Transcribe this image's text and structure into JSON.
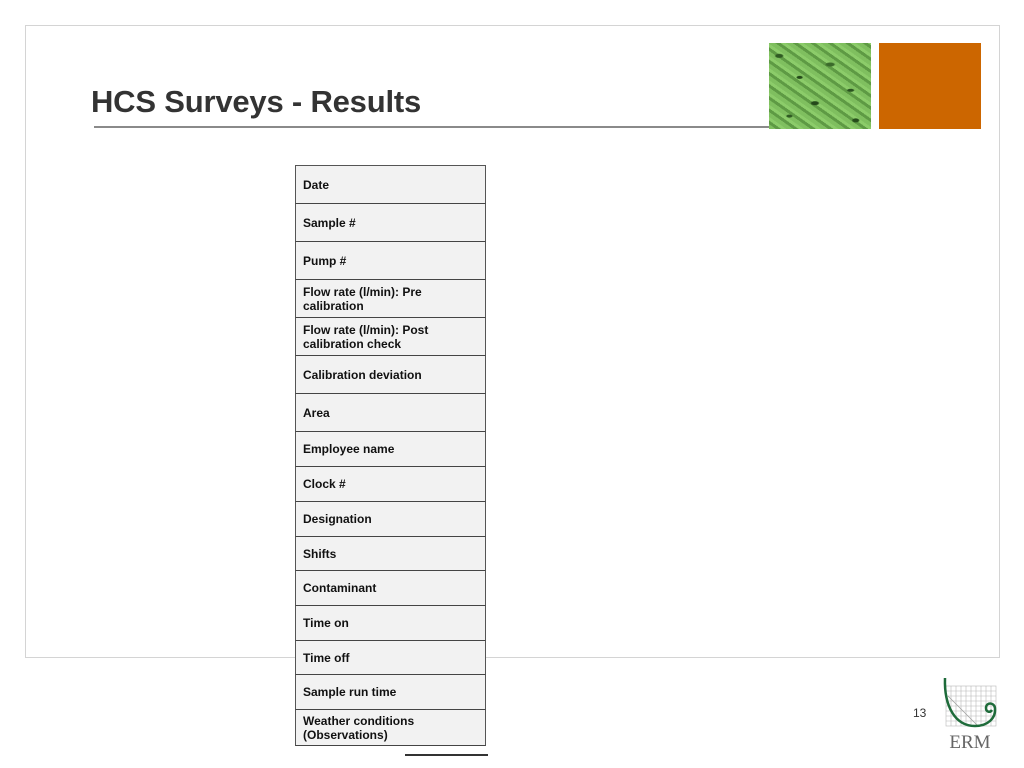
{
  "slide": {
    "title": "HCS Surveys - Results",
    "page_number": "13",
    "logo_text": "ERM",
    "accent_color": "#cc6600",
    "logo_green": "#1e6b3a"
  },
  "table": {
    "rows": [
      {
        "label": "Date"
      },
      {
        "label": "Sample #"
      },
      {
        "label": "Pump #"
      },
      {
        "label": "Flow rate (l/min):  Pre calibration"
      },
      {
        "label": "Flow rate (l/min):  Post calibration check"
      },
      {
        "label": "Calibration deviation"
      },
      {
        "label": "Area"
      },
      {
        "label": "Employee name"
      },
      {
        "label": "Clock #"
      },
      {
        "label": "Designation"
      },
      {
        "label": "Shifts"
      },
      {
        "label": "Contaminant"
      },
      {
        "label": "Time on"
      },
      {
        "label": "Time off"
      },
      {
        "label": "Sample run time"
      },
      {
        "label": "Weather conditions (Observations)"
      }
    ]
  }
}
